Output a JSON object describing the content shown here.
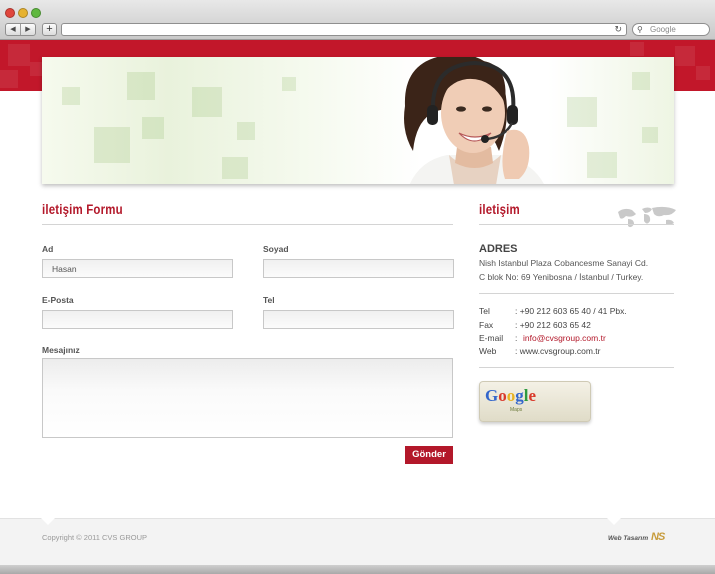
{
  "browser": {
    "back_label": "◀",
    "forward_label": "▶",
    "add_label": "+",
    "reload_label": "↻",
    "search_placeholder": "Google",
    "search_icon": "magnifier-icon"
  },
  "form": {
    "title": "iletişim Formu",
    "ad_label": "Ad",
    "ad_value": "Hasan",
    "soyad_label": "Soyad",
    "soyad_value": "",
    "eposta_label": "E-Posta",
    "eposta_value": "",
    "tel_label": "Tel",
    "tel_value": "",
    "mesaj_label": "Mesajınız",
    "mesaj_value": "",
    "submit_label": "Gönder"
  },
  "contact": {
    "title": "iletişim",
    "adres_title": "ADRES",
    "adres_line1": "Nish Istanbul Plaza Cobancesme Sanayi Cd.",
    "adres_line2": "C blok No: 69 Yenibosna / İstanbul / Turkey.",
    "tel_label": "Tel",
    "tel_value": ":  +90 212 603 65 40 / 41 Pbx.",
    "fax_label": "Fax",
    "fax_value": ":  +90 212 603 65 42",
    "email_label": "E-mail",
    "email_value": "info@cvsgroup.com.tr",
    "email_colon": ":",
    "web_label": "Web",
    "web_value": ":  www.cvsgroup.com.tr",
    "maps_logo": "Google",
    "maps_sub": "Maps"
  },
  "footer": {
    "copyright": "Copyright © 2011 CVS GROUP",
    "web_tasarim": "Web Tasarım",
    "logo_text": "NS"
  },
  "colors": {
    "brand_red": "#c2172a",
    "heading_red": "#b3182a"
  }
}
